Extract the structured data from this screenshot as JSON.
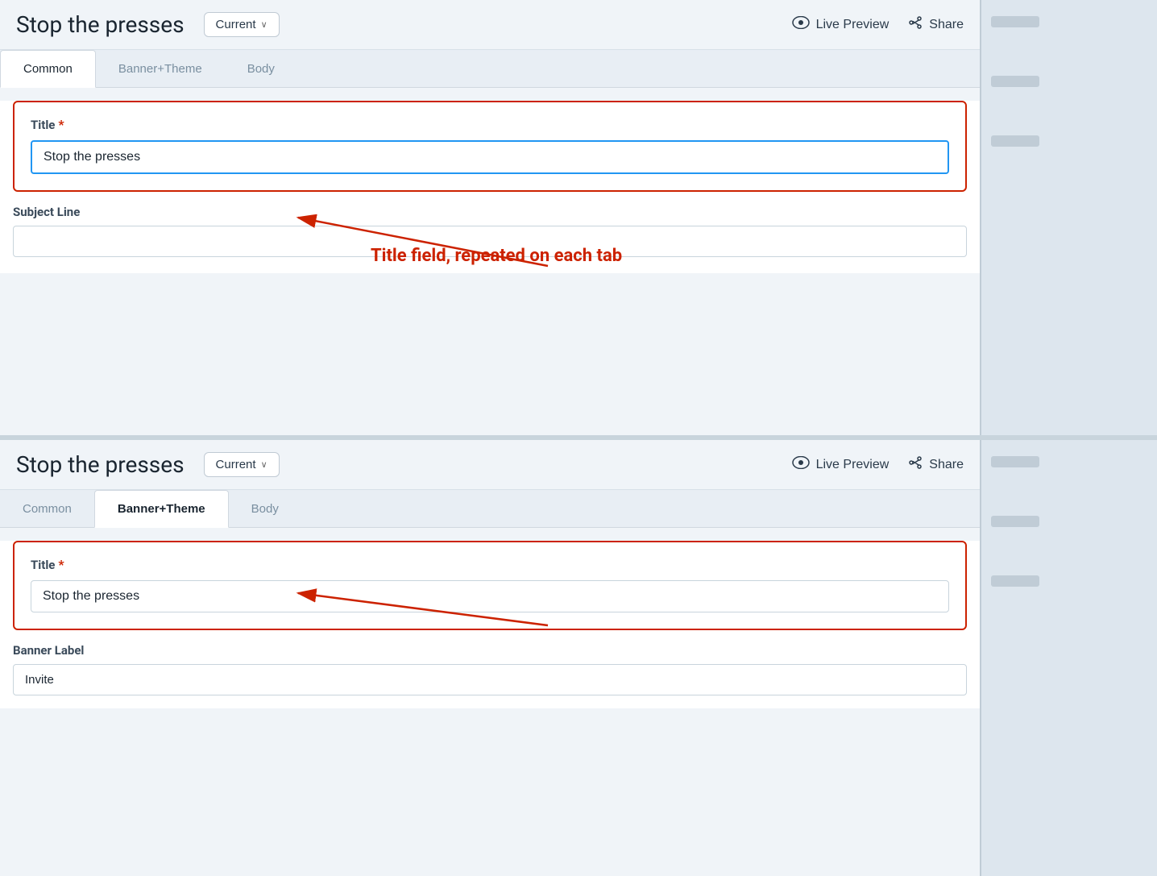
{
  "top_panel": {
    "title": "Stop the presses",
    "version_btn": "Current",
    "version_chevron": "∨",
    "live_preview_label": "Live Preview",
    "share_label": "Share",
    "tabs": [
      {
        "id": "common",
        "label": "Common",
        "active": true
      },
      {
        "id": "banner_theme",
        "label": "Banner+Theme",
        "active": false
      },
      {
        "id": "body",
        "label": "Body",
        "active": false
      }
    ],
    "title_field": {
      "label": "Title",
      "required": true,
      "value": "Stop the presses",
      "placeholder": ""
    },
    "subject_field": {
      "label": "Subject Line",
      "value": "",
      "placeholder": ""
    }
  },
  "annotation": {
    "text": "Title field, repeated on each tab",
    "arrow_color": "#cc2200"
  },
  "bottom_panel": {
    "title": "Stop the presses",
    "version_btn": "Current",
    "version_chevron": "∨",
    "live_preview_label": "Live Preview",
    "share_label": "Share",
    "tabs": [
      {
        "id": "common",
        "label": "Common",
        "active": false
      },
      {
        "id": "banner_theme",
        "label": "Banner+Theme",
        "active": true
      },
      {
        "id": "body",
        "label": "Body",
        "active": false
      }
    ],
    "title_field": {
      "label": "Title",
      "required": true,
      "value": "Stop the presses",
      "placeholder": ""
    },
    "banner_label_field": {
      "label": "Banner Label",
      "value": "Invite",
      "placeholder": ""
    }
  }
}
